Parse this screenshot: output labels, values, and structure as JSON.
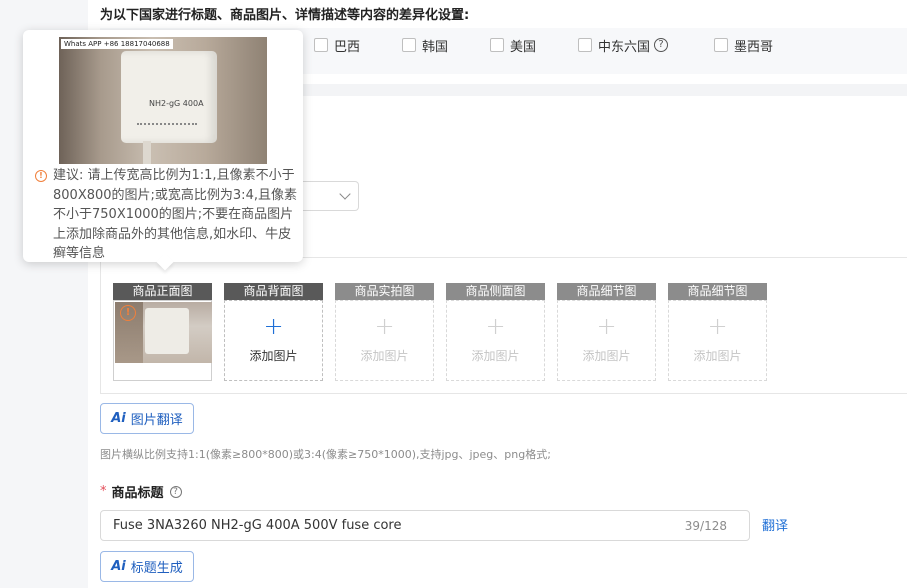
{
  "heading": "为以下国家进行标题、商品图片、详情描述等内容的差异化设置:",
  "countries": [
    {
      "label": "巴西"
    },
    {
      "label": "韩国"
    },
    {
      "label": "美国"
    },
    {
      "label": "中东六国",
      "help_icon": "question-circle-icon"
    },
    {
      "label": "墨西哥"
    }
  ],
  "tooltip": {
    "watermark": "Whats APP +86 18817040688",
    "product_label": "NH2-gG 400A",
    "advice": "建议: 请上传宽高比例为1:1,且像素不小于800X800的图片;或宽高比例为3:4,且像素不小于750X1000的图片;不要在商品图片上添加除商品外的其他信息,如水印、牛皮癣等信息"
  },
  "image_slots": [
    {
      "label": "商品正面图",
      "filled": true
    },
    {
      "label": "商品背面图",
      "add_text": "添加图片",
      "active": true
    },
    {
      "label": "商品实拍图",
      "add_text": "添加图片"
    },
    {
      "label": "商品侧面图",
      "add_text": "添加图片"
    },
    {
      "label": "商品细节图",
      "add_text": "添加图片"
    },
    {
      "label": "商品细节图",
      "add_text": "添加图片"
    }
  ],
  "image_translate_button": {
    "ai": "Ai",
    "label": "图片翻译"
  },
  "image_hint": "图片横纵比例支持1:1(像素≥800*800)或3:4(像素≥750*1000),支持jpg、jpeg、png格式;",
  "title_field": {
    "required_mark": "*",
    "label": "商品标题",
    "value": "Fuse 3NA3260 NH2-gG 400A 500V fuse core",
    "count": "39/128",
    "translate_link": "翻译"
  },
  "title_generate_button": {
    "ai": "Ai",
    "label": "标题生成"
  },
  "colors": {
    "accent": "#1f6fd6",
    "warning": "#f0803c",
    "required": "#e34d59"
  }
}
